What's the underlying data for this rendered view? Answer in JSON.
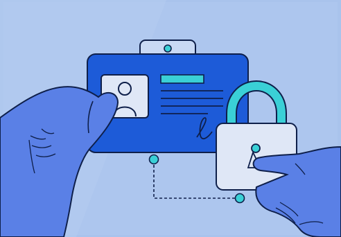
{
  "illustration": {
    "subject": "id-card-with-padlock",
    "icons": [
      "id-badge-icon",
      "user-avatar-icon",
      "signature-icon",
      "padlock-icon",
      "keyhole-icon",
      "hand-icon",
      "connector-node-icon"
    ]
  },
  "colors": {
    "background": "#a9c3ec",
    "background_light": "#c9d9f4",
    "card": "#1d5bd8",
    "card_outline": "#0e1f4a",
    "accent_teal": "#3ad0d6",
    "photo_frame": "#dfe7f6",
    "hand": "#5a80e6",
    "hand_shadow": "#4a6fd8",
    "lock_body": "#dfe7f6",
    "lock_shackle": "#3ad0d6",
    "outline": "#0e1f4a"
  }
}
